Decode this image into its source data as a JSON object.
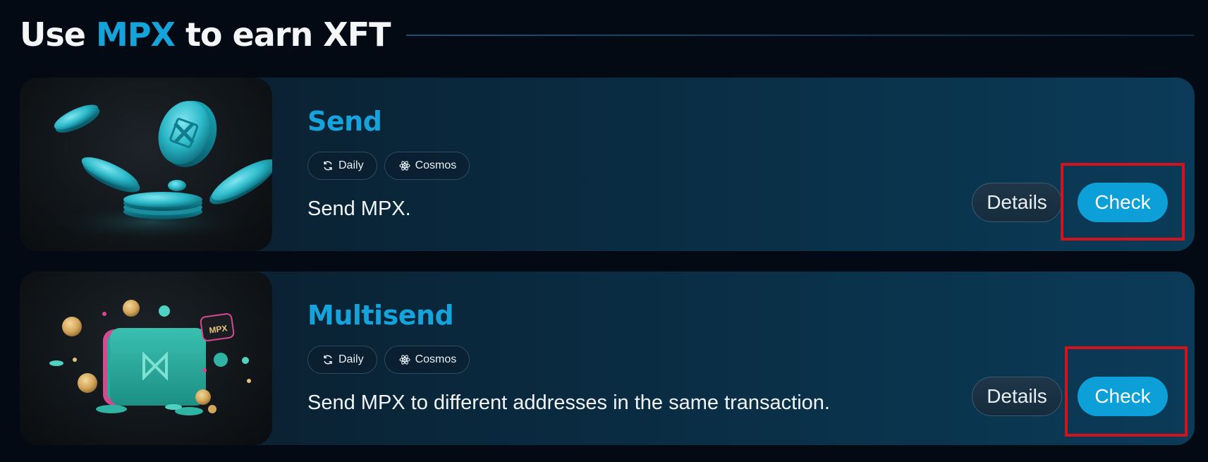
{
  "header": {
    "title_prefix": "Use",
    "title_accent": "MPX",
    "title_suffix": "to earn XFT"
  },
  "tasks": [
    {
      "title": "Send",
      "tags": [
        {
          "icon": "refresh-icon",
          "label": "Daily"
        },
        {
          "icon": "cosmos-icon",
          "label": "Cosmos"
        }
      ],
      "description": "Send MPX.",
      "details_label": "Details",
      "check_label": "Check",
      "image": "floating-coins-image"
    },
    {
      "title": "Multisend",
      "tags": [
        {
          "icon": "refresh-icon",
          "label": "Daily"
        },
        {
          "icon": "cosmos-icon",
          "label": "Cosmos"
        }
      ],
      "description": "Send MPX to different addresses in the same transaction.",
      "details_label": "Details",
      "check_label": "Check",
      "image": "wallet-with-coins-image",
      "image_badge": "MPX"
    }
  ],
  "colors": {
    "accent": "#15a3dc",
    "check_button": "#0c9fd8",
    "highlight_box": "#d4121b",
    "background": "#040a14"
  }
}
